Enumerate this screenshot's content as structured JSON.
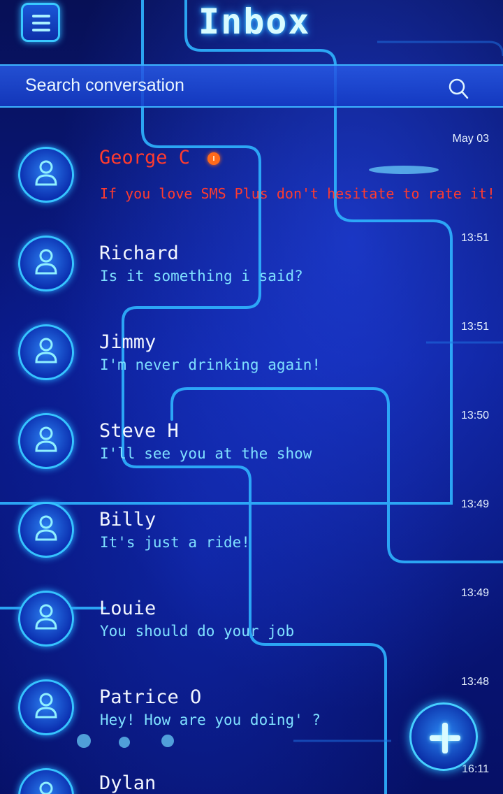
{
  "header": {
    "title": "Inbox",
    "menu_icon": "menu-icon"
  },
  "search": {
    "placeholder": "Search conversation",
    "icon": "search-icon"
  },
  "conversations": [
    {
      "name": "George C",
      "message": "If you love SMS Plus don't hesitate to rate it!",
      "time": "May 03",
      "unread": true
    },
    {
      "name": "Richard",
      "message": "Is it something i said?",
      "time": "13:51",
      "unread": false
    },
    {
      "name": "Jimmy",
      "message": "I'm never drinking again!",
      "time": "13:51",
      "unread": false
    },
    {
      "name": "Steve H",
      "message": "I'll see you at the show",
      "time": "13:50",
      "unread": false
    },
    {
      "name": "Billy",
      "message": "It's just a ride!",
      "time": "13:49",
      "unread": false
    },
    {
      "name": "Louie",
      "message": "You should do your job",
      "time": "13:49",
      "unread": false
    },
    {
      "name": "Patrice O",
      "message": "Hey! How are you doing' ?",
      "time": "13:48",
      "unread": false
    },
    {
      "name": "Dylan",
      "message": "",
      "time": "16:11",
      "unread": false
    }
  ],
  "fab": {
    "icon": "plus-icon"
  },
  "colors": {
    "accent": "#36c4ff",
    "unread": "#ff3b2e",
    "message": "#7fe0ff",
    "background": "#0a1a8a"
  }
}
